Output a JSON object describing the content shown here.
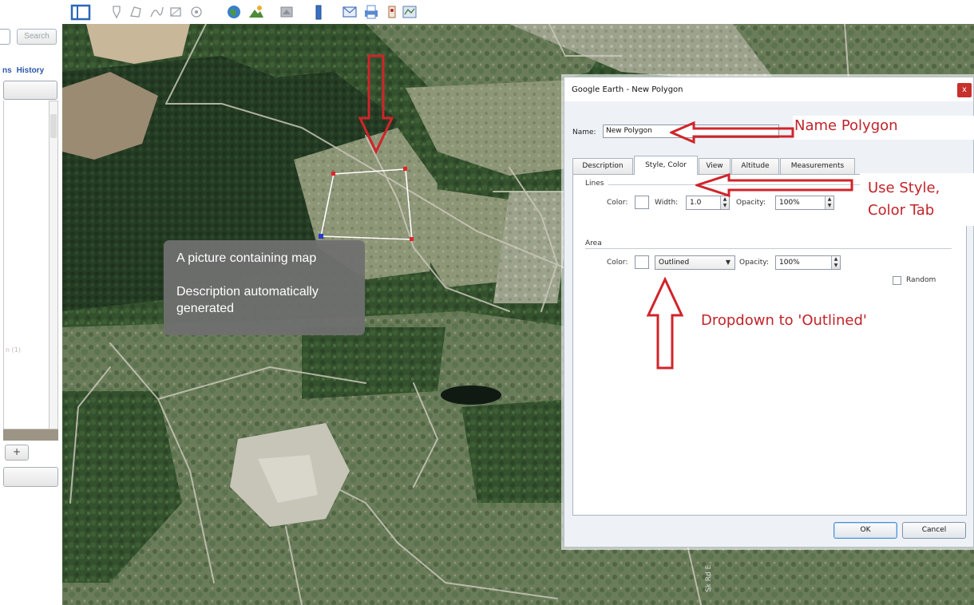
{
  "left_panel": {
    "search_label": "Search",
    "tabs": [
      "ns",
      "History"
    ],
    "list_item_fragment": "n (1)",
    "add_label": "+"
  },
  "toolbar": {
    "icons": [
      "sidebar-icon",
      "placemark-icon",
      "polygon-icon",
      "path-icon",
      "image-overlay-icon",
      "record-tour-icon",
      "historical-imagery-icon",
      "sun-icon",
      "planets-icon",
      "ruler-icon",
      "email-icon",
      "print-icon",
      "save-image-icon",
      "maps-icon"
    ]
  },
  "map": {
    "tooltip": {
      "line1": "A picture containing map",
      "line2": "Description automatically generated"
    },
    "road_label": "Sk Rd E"
  },
  "dialog": {
    "title": "Google Earth - New Polygon",
    "close_label": "x",
    "name_label": "Name:",
    "name_value": "New Polygon",
    "tabs": [
      "Description",
      "Style, Color",
      "View",
      "Altitude",
      "Measurements"
    ],
    "active_tab": "Style, Color",
    "lines": {
      "title": "Lines",
      "color_label": "Color:",
      "width_label": "Width:",
      "width_value": "1.0",
      "opacity_label": "Opacity:",
      "opacity_value": "100%"
    },
    "area": {
      "title": "Area",
      "color_label": "Color:",
      "fill_value": "Outlined",
      "opacity_label": "Opacity:",
      "opacity_value": "100%",
      "random_label": "Random"
    },
    "ok_label": "OK",
    "cancel_label": "Cancel"
  },
  "annotations": {
    "name_polygon": "Name Polygon",
    "use_style_line1": "Use Style,",
    "use_style_line2": "Color Tab",
    "dropdown": "Dropdown to 'Outlined'",
    "color": "#c0242a"
  },
  "colors": {
    "forest": "#2a4a2c",
    "clearing": "#8d9374",
    "tooltip_bg": "#707070",
    "dialog_bg": "#eef2f7"
  }
}
